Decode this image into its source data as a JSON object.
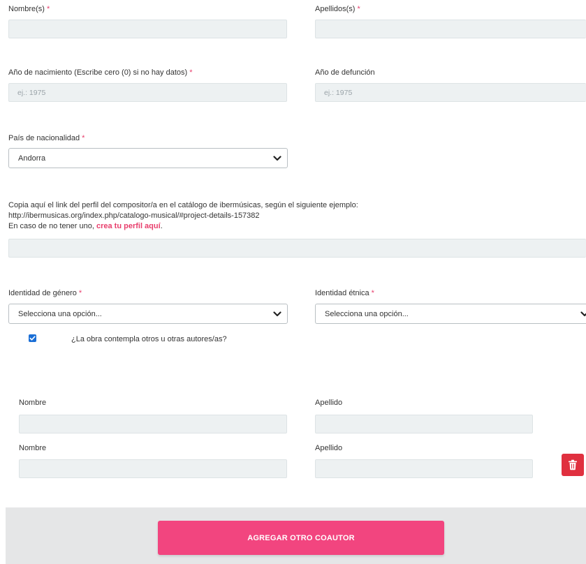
{
  "form": {
    "nombres": {
      "label": "Nombre(s)",
      "required_mark": "*",
      "value": ""
    },
    "apellidos": {
      "label": "Apellidos(s)",
      "required_mark": "*",
      "value": ""
    },
    "nacimiento": {
      "label": "Año de nacimiento (Escribe cero (0) si no hay datos)",
      "required_mark": "*",
      "placeholder": "ej.: 1975"
    },
    "defuncion": {
      "label": "Año de defunción",
      "placeholder": "ej.: 1975"
    },
    "pais": {
      "label": "País de nacionalidad",
      "required_mark": "*",
      "selected": "Andorra"
    },
    "perfil": {
      "line1": "Copia aquí el link del perfil del compositor/a en el catálogo de ibermúsicas, según el siguiente ejemplo:",
      "line2": "http://ibermusicas.org/index.php/catalogo-musical/#project-details-157382",
      "line3_prefix": "En caso de no tener uno, ",
      "line3_link": "crea tu perfil aquí",
      "line3_suffix": ".",
      "value": ""
    },
    "genero": {
      "label": "Identidad de género",
      "required_mark": "*",
      "selected": "Selecciona una opción..."
    },
    "etnica": {
      "label": "Identidad étnica",
      "required_mark": "*",
      "selected": "Selecciona una opción..."
    },
    "coautores_check": {
      "label": "¿La obra contempla otros u otras autores/as?",
      "checked": true
    },
    "coautores": [
      {
        "nombre_label": "Nombre",
        "apellido_label": "Apellido"
      },
      {
        "nombre_label": "Nombre",
        "apellido_label": "Apellido"
      }
    ],
    "add_button": "AGREGAR OTRO COAUTOR"
  },
  "icons": {
    "chevron": "chevron-down-icon",
    "check": "check-icon",
    "delete": "trash-icon"
  },
  "colors": {
    "required": "#e83e6c",
    "button": "#f2457f",
    "delete": "#e0303f",
    "checkbox": "#1b6fd6"
  }
}
